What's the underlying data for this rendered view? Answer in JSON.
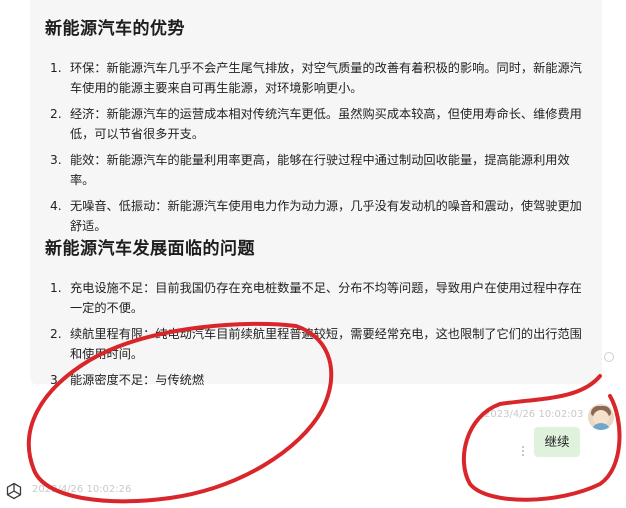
{
  "advantages": {
    "title": "新能源汽车的优势",
    "items": [
      {
        "num": "1.",
        "text": "环保：新能源汽车几乎不会产生尾气排放，对空气质量的改善有着积极的影响。同时，新能源汽车使用的能源主要来自可再生能源，对环境影响更小。"
      },
      {
        "num": "2.",
        "text": "经济：新能源汽车的运营成本相对传统汽车更低。虽然购买成本较高，但使用寿命长、维修费用低，可以节省很多开支。"
      },
      {
        "num": "3.",
        "text": "能效：新能源汽车的能量利用率更高，能够在行驶过程中通过制动回收能量，提高能源利用效率。"
      },
      {
        "num": "4.",
        "text": "无噪音、低振动：新能源汽车使用电力作为动力源，几乎没有发动机的噪音和震动，使驾驶更加舒适。"
      }
    ]
  },
  "problems": {
    "title": "新能源汽车发展面临的问题",
    "items": [
      {
        "num": "1.",
        "text": "充电设施不足：目前我国仍存在充电桩数量不足、分布不均等问题，导致用户在使用过程中存在一定的不便。"
      },
      {
        "num": "2.",
        "text": "续航里程有限：纯电动汽车目前续航里程普遍较短，需要经常充电，这也限制了它们的出行范围和使用时间。"
      },
      {
        "num": "3.",
        "text": "能源密度不足：与传统燃"
      }
    ]
  },
  "user_message": {
    "timestamp": "2023/4/26 10:02:03",
    "text": "继续"
  },
  "assistant_next": {
    "timestamp": "2023/4/26 10:02:26"
  },
  "colors": {
    "panel_bg": "#f6f6f7",
    "user_bubble": "#dff3dc",
    "annotation_red": "#d9262a"
  },
  "icons": [
    "openai-icon",
    "user-avatar",
    "more-options-icon"
  ]
}
